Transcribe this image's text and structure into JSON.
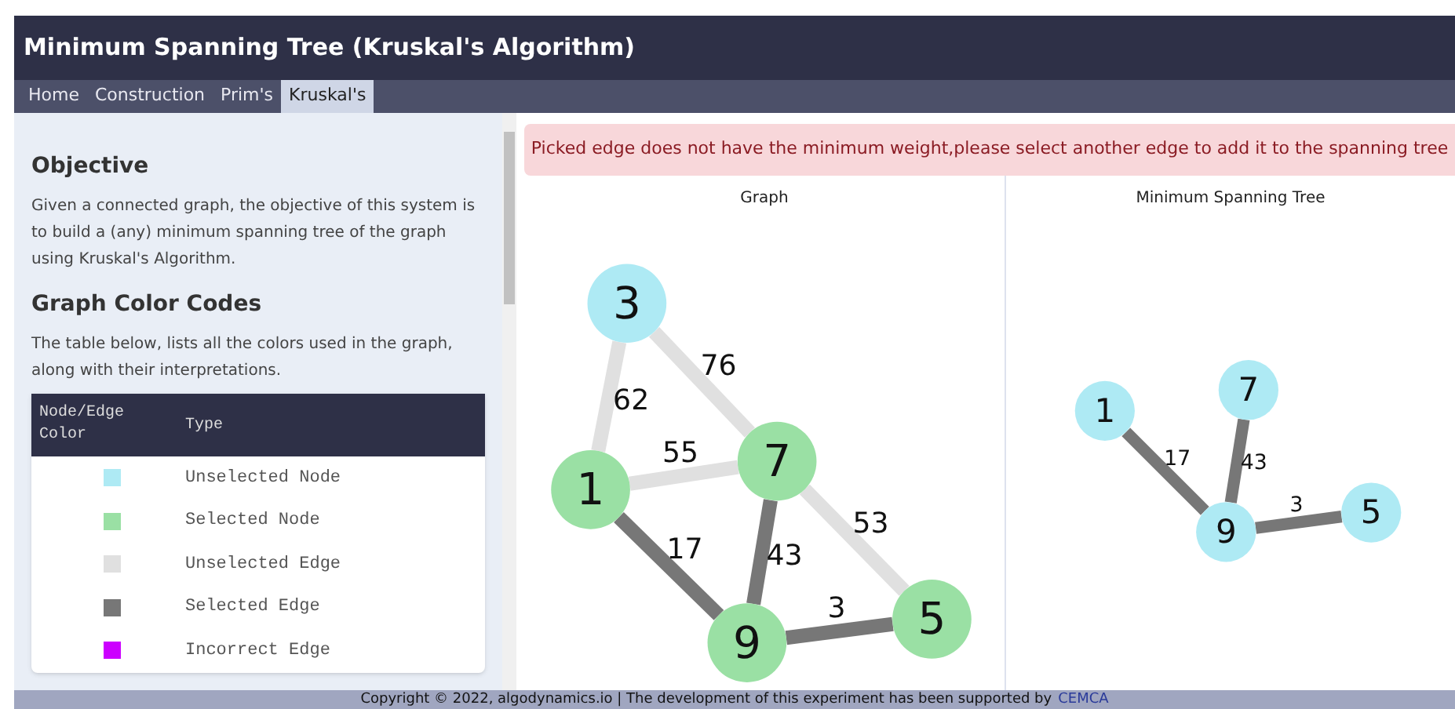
{
  "window": {
    "title": "Minimum Spanning Tree (Kruskal's Algorithm)"
  },
  "tabs": [
    {
      "label": "Home",
      "selected": false
    },
    {
      "label": "Construction",
      "selected": false
    },
    {
      "label": "Prim's",
      "selected": false
    },
    {
      "label": "Kruskal's",
      "selected": true
    }
  ],
  "sidebar": {
    "objective_heading": "Objective",
    "objective_text": "Given a connected graph, the objective of this system is to build a (any) minimum spanning tree of the graph using Kruskal's Algorithm.",
    "colors_heading": "Graph Color Codes",
    "colors_text": "The table below, lists all the colors used in the graph, along with their interpretations.",
    "table": {
      "columns": [
        "Node/Edge Color",
        "Type"
      ],
      "rows": [
        {
          "color": "#aeeaf4",
          "type": "Unselected Node"
        },
        {
          "color": "#9ae0a4",
          "type": "Selected Node"
        },
        {
          "color": "#e0e0e0",
          "type": "Unselected Edge"
        },
        {
          "color": "#777777",
          "type": "Selected Edge"
        },
        {
          "color": "#cc00ff",
          "type": "Incorrect Edge"
        }
      ]
    }
  },
  "alert": "Picked edge does not have the minimum weight,please select another edge to add it to the spanning tree",
  "graph": {
    "title": "Graph",
    "nodes": [
      {
        "label": "3",
        "selected": false
      },
      {
        "label": "1",
        "selected": true
      },
      {
        "label": "7",
        "selected": true
      },
      {
        "label": "9",
        "selected": true
      },
      {
        "label": "5",
        "selected": true
      }
    ],
    "edges": [
      {
        "weight": "62",
        "selected": false
      },
      {
        "weight": "76",
        "selected": false
      },
      {
        "weight": "55",
        "selected": false
      },
      {
        "weight": "53",
        "selected": false
      },
      {
        "weight": "17",
        "selected": true
      },
      {
        "weight": "43",
        "selected": true
      },
      {
        "weight": "3",
        "selected": true
      }
    ]
  },
  "tree": {
    "title": "Minimum Spanning Tree",
    "nodes": [
      {
        "label": "1",
        "selected": false
      },
      {
        "label": "7",
        "selected": false
      },
      {
        "label": "9",
        "selected": false
      },
      {
        "label": "5",
        "selected": false
      }
    ],
    "edges": [
      {
        "weight": "17",
        "selected": true
      },
      {
        "weight": "43",
        "selected": true
      },
      {
        "weight": "3",
        "selected": true
      }
    ]
  },
  "footer": {
    "text": "Copyright © 2022, algodynamics.io | The development of this experiment has been supported by",
    "link": "CEMCA"
  }
}
